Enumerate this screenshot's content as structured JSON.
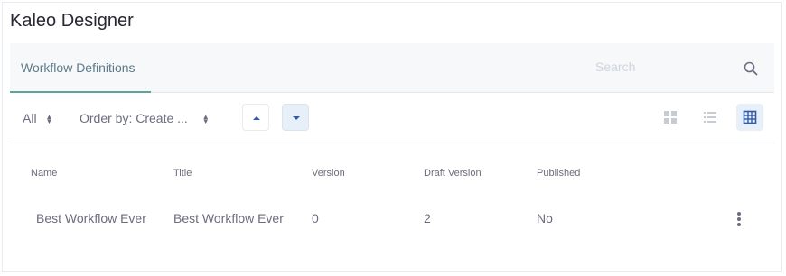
{
  "page": {
    "title": "Kaleo Designer"
  },
  "nav": {
    "tab_label": "Workflow Definitions",
    "search_placeholder": "Search"
  },
  "management": {
    "filter_label": "All",
    "order_by_label": "Order by: Create ...",
    "sort_ascending": "ascending",
    "sort_descending": "descending",
    "active_view": "table"
  },
  "table": {
    "columns": [
      "Name",
      "Title",
      "Version",
      "Draft Version",
      "Published"
    ],
    "rows": [
      {
        "name": "Best Workflow Ever",
        "title": "Best Workflow Ever",
        "version": "0",
        "draft_version": "2",
        "published": "No"
      }
    ]
  },
  "icons": {
    "search": "search-icon",
    "sort_up": "caret-up-icon",
    "sort_down": "caret-down-icon",
    "view_cards": "cards-view-icon",
    "view_list": "list-view-icon",
    "view_table": "table-view-icon",
    "row_actions": "ellipsis-vertical-icon"
  },
  "colors": {
    "accent": "#5fa39c",
    "active_button_bg": "#e7eff9",
    "primary_icon": "#2e5aac",
    "text": "#6b6c7e"
  }
}
